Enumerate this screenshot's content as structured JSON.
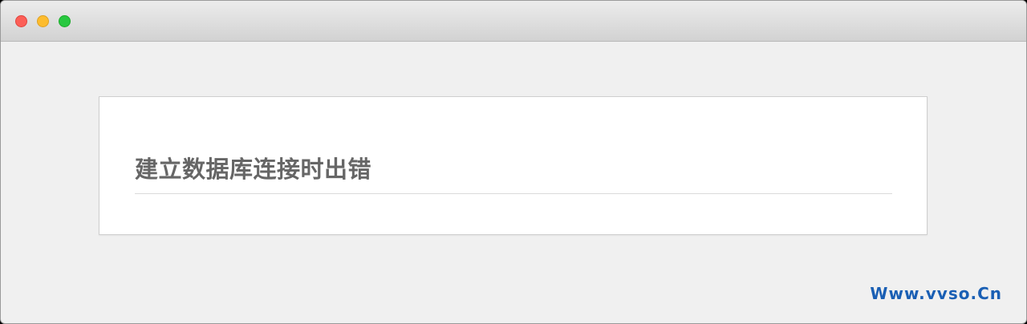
{
  "window": {
    "controls": [
      "close",
      "minimize",
      "zoom"
    ]
  },
  "error": {
    "title": "建立数据库连接时出错"
  },
  "watermark": {
    "text": "Www.vvso.Cn",
    "color": "#1a5fb4"
  },
  "colors": {
    "background": "#f0f0f0",
    "panel": "#ffffff",
    "title_text": "#666666",
    "close": "#fc5f57",
    "minimize": "#fdbc2e",
    "zoom": "#28c840"
  }
}
